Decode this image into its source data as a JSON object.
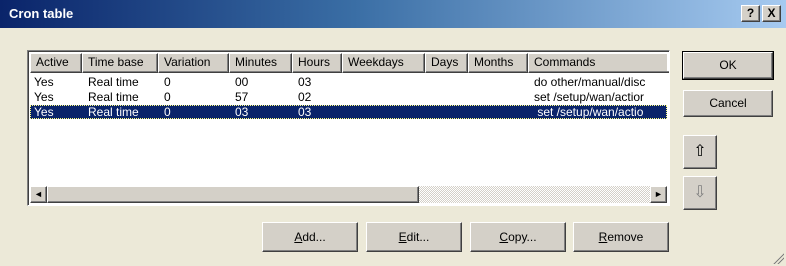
{
  "window": {
    "title": "Cron table",
    "help_label": "?",
    "close_label": "X"
  },
  "table": {
    "columns": [
      "Active",
      "Time base",
      "Variation",
      "Minutes",
      "Hours",
      "Weekdays",
      "Days",
      "Months",
      "Commands"
    ],
    "rows": [
      [
        "Yes",
        "Real time",
        "0",
        "00",
        "03",
        "",
        "",
        "",
        "do other/manual/disc"
      ],
      [
        "Yes",
        "Real time",
        "0",
        "57",
        "02",
        "",
        "",
        "",
        "set /setup/wan/actior"
      ],
      [
        "Yes",
        "Real time",
        "0",
        "03",
        "03",
        "",
        "",
        "",
        " set /setup/wan/actio"
      ]
    ],
    "selected_row": 2
  },
  "scrollbar": {
    "left_arrow": "◄",
    "right_arrow": "►"
  },
  "buttons": {
    "ok": "OK",
    "cancel": "Cancel",
    "move_up": "⇧",
    "move_down": "⇩",
    "add": "Add...",
    "edit": "Edit...",
    "copy": "Copy...",
    "remove": "Remove"
  },
  "colors": {
    "selection": "#0a246a",
    "dialog_bg": "#ece9d8",
    "titlebar": "#0a246a"
  }
}
